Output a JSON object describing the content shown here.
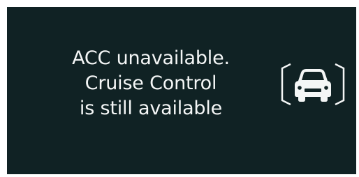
{
  "alert": {
    "line1": "ACC unavailable.",
    "line2": "Cruise Control",
    "line3": "is still available",
    "icon": "acc-unavailable-car-icon"
  },
  "colors": {
    "background": "#102224",
    "text": "#f4f6f6",
    "icon": "#f4f6f6"
  }
}
